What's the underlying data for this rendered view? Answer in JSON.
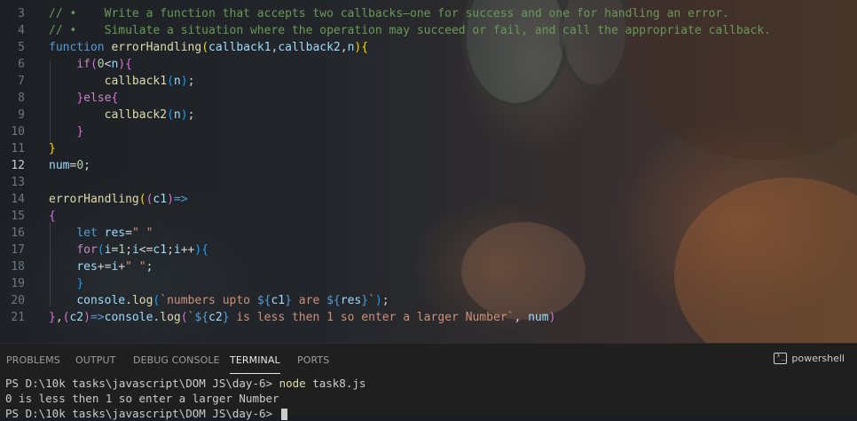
{
  "editor": {
    "lines": [
      {
        "n": "3",
        "tokens": [
          [
            "cm",
            "// •    Write a function that accepts two callbacks—one for success and one for handling an error."
          ]
        ]
      },
      {
        "n": "4",
        "tokens": [
          [
            "cm",
            "// •    Simulate a situation where the operation may succeed or fail, and call the appropriate callback."
          ]
        ]
      },
      {
        "n": "5",
        "tokens": [
          [
            "kw",
            "function "
          ],
          [
            "fn",
            "errorHandling"
          ],
          [
            "br1",
            "("
          ],
          [
            "vr",
            "callback1"
          ],
          [
            "op",
            ","
          ],
          [
            "vr",
            "callback2"
          ],
          [
            "op",
            ","
          ],
          [
            "vr",
            "n"
          ],
          [
            "br1",
            ")"
          ],
          [
            "br1",
            "{"
          ]
        ]
      },
      {
        "n": "6",
        "tokens": [
          [
            "op",
            "    "
          ],
          [
            "kw2",
            "if"
          ],
          [
            "br2",
            "("
          ],
          [
            "nm",
            "0"
          ],
          [
            "op",
            "<"
          ],
          [
            "vr",
            "n"
          ],
          [
            "br2",
            ")"
          ],
          [
            "br2",
            "{"
          ]
        ]
      },
      {
        "n": "7",
        "tokens": [
          [
            "op",
            "        "
          ],
          [
            "fn",
            "callback1"
          ],
          [
            "br3",
            "("
          ],
          [
            "vr",
            "n"
          ],
          [
            "br3",
            ")"
          ],
          [
            "op",
            ";"
          ]
        ]
      },
      {
        "n": "8",
        "tokens": [
          [
            "op",
            "    "
          ],
          [
            "br2",
            "}"
          ],
          [
            "kw2",
            "else"
          ],
          [
            "br2",
            "{"
          ]
        ]
      },
      {
        "n": "9",
        "tokens": [
          [
            "op",
            "        "
          ],
          [
            "fn",
            "callback2"
          ],
          [
            "br3",
            "("
          ],
          [
            "vr",
            "n"
          ],
          [
            "br3",
            ")"
          ],
          [
            "op",
            ";"
          ]
        ]
      },
      {
        "n": "10",
        "tokens": [
          [
            "op",
            "    "
          ],
          [
            "br2",
            "}"
          ]
        ]
      },
      {
        "n": "11",
        "tokens": [
          [
            "br1",
            "}"
          ]
        ]
      },
      {
        "n": "12",
        "tokens": [
          [
            "vr",
            "num"
          ],
          [
            "op",
            "="
          ],
          [
            "nm",
            "0"
          ],
          [
            "op",
            ";"
          ]
        ],
        "active": true
      },
      {
        "n": "13",
        "tokens": []
      },
      {
        "n": "14",
        "tokens": [
          [
            "fn",
            "errorHandling"
          ],
          [
            "br1",
            "("
          ],
          [
            "br2",
            "("
          ],
          [
            "vr",
            "c1"
          ],
          [
            "br2",
            ")"
          ],
          [
            "kw",
            "=>"
          ]
        ]
      },
      {
        "n": "15",
        "tokens": [
          [
            "br2",
            "{"
          ]
        ]
      },
      {
        "n": "16",
        "tokens": [
          [
            "op",
            "    "
          ],
          [
            "kw",
            "let "
          ],
          [
            "vr",
            "res"
          ],
          [
            "op",
            "="
          ],
          [
            "st",
            "\" \""
          ]
        ]
      },
      {
        "n": "17",
        "tokens": [
          [
            "op",
            "    "
          ],
          [
            "kw2",
            "for"
          ],
          [
            "br3",
            "("
          ],
          [
            "vr",
            "i"
          ],
          [
            "op",
            "="
          ],
          [
            "nm",
            "1"
          ],
          [
            "op",
            ";"
          ],
          [
            "vr",
            "i"
          ],
          [
            "op",
            "<="
          ],
          [
            "vr",
            "c1"
          ],
          [
            "op",
            ";"
          ],
          [
            "vr",
            "i"
          ],
          [
            "op",
            "++"
          ],
          [
            "br3",
            ")"
          ],
          [
            "br3",
            "{"
          ]
        ]
      },
      {
        "n": "18",
        "tokens": [
          [
            "op",
            "    "
          ],
          [
            "vr",
            "res"
          ],
          [
            "op",
            "+="
          ],
          [
            "vr",
            "i"
          ],
          [
            "op",
            "+"
          ],
          [
            "st",
            "\" \""
          ],
          [
            "op",
            ";"
          ]
        ]
      },
      {
        "n": "19",
        "tokens": [
          [
            "op",
            "    "
          ],
          [
            "br3",
            "}"
          ]
        ]
      },
      {
        "n": "20",
        "tokens": [
          [
            "op",
            "    "
          ],
          [
            "vr",
            "console"
          ],
          [
            "op",
            "."
          ],
          [
            "fn",
            "log"
          ],
          [
            "br3",
            "("
          ],
          [
            "st",
            "`numbers upto "
          ],
          [
            "kw",
            "${"
          ],
          [
            "vr",
            "c1"
          ],
          [
            "kw",
            "}"
          ],
          [
            "st",
            " are "
          ],
          [
            "kw",
            "${"
          ],
          [
            "vr",
            "res"
          ],
          [
            "kw",
            "}"
          ],
          [
            "st",
            "`"
          ],
          [
            "br3",
            ")"
          ],
          [
            "op",
            ";"
          ]
        ]
      },
      {
        "n": "21",
        "tokens": [
          [
            "br2",
            "}"
          ],
          [
            "op",
            ","
          ],
          [
            "br2",
            "("
          ],
          [
            "vr",
            "c2"
          ],
          [
            "br2",
            ")"
          ],
          [
            "kw",
            "=>"
          ],
          [
            "vr",
            "console"
          ],
          [
            "op",
            "."
          ],
          [
            "fn",
            "log"
          ],
          [
            "br2",
            "("
          ],
          [
            "st",
            "`"
          ],
          [
            "kw",
            "${"
          ],
          [
            "vr",
            "c2"
          ],
          [
            "kw",
            "}"
          ],
          [
            "st",
            " is less then 1 so enter a larger Number`"
          ],
          [
            "op",
            ", "
          ],
          [
            "vr",
            "num"
          ],
          [
            "br2",
            ")"
          ]
        ]
      }
    ]
  },
  "panel": {
    "tabs": [
      "PROBLEMS",
      "OUTPUT",
      "DEBUG CONSOLE",
      "TERMINAL",
      "PORTS"
    ],
    "active_tab": "TERMINAL",
    "shell_label": "powershell",
    "terminal": {
      "line1_prompt": "PS D:\\10k tasks\\javascript\\DOM JS\\day-6> ",
      "line1_cmd": "node",
      "line1_arg": " task8.js",
      "line2": "0 is less then 1 so enter a larger Number",
      "line3_prompt": "PS D:\\10k tasks\\javascript\\DOM JS\\day-6> "
    }
  },
  "colors": {
    "comment": "#6a9955",
    "keyword": "#569cd6",
    "control": "#c586c0",
    "function": "#dcdcaa",
    "variable": "#9cdcfe",
    "number": "#b5cea8",
    "string": "#ce9178"
  }
}
